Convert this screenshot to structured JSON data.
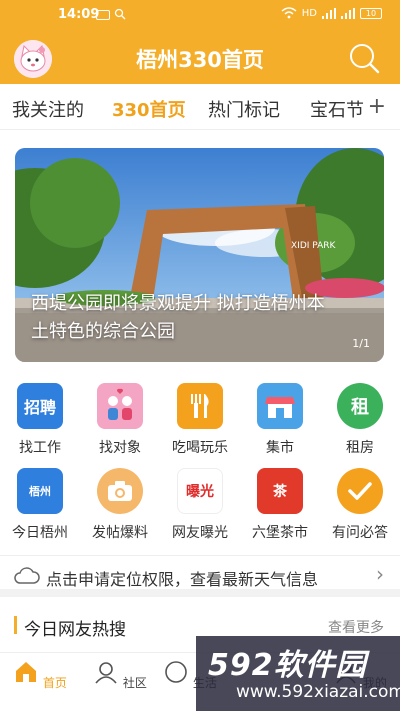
{
  "status": {
    "time": "14:09",
    "battery": "10",
    "network": "HD"
  },
  "header": {
    "title": "梧州330首页"
  },
  "tabs": [
    {
      "label": "我关注的"
    },
    {
      "label": "330首页"
    },
    {
      "label": "热门标记"
    },
    {
      "label": "宝石节"
    }
  ],
  "banner": {
    "caption": "西堤公园即将景观提升 拟打造梧州本土特色的综合公园",
    "pager": "1/1",
    "park_sign": "XIDI PARK"
  },
  "grid": [
    {
      "label": "找工作",
      "icon": "recruit-icon",
      "glyph": "招聘"
    },
    {
      "label": "找对象",
      "icon": "dating-icon",
      "glyph": ""
    },
    {
      "label": "吃喝玩乐",
      "icon": "food-icon",
      "glyph": ""
    },
    {
      "label": "集市",
      "icon": "market-icon",
      "glyph": ""
    },
    {
      "label": "租房",
      "icon": "rent-icon",
      "glyph": "租"
    },
    {
      "label": "今日梧州",
      "icon": "map-icon",
      "glyph": "梧州"
    },
    {
      "label": "发帖爆料",
      "icon": "camera-icon",
      "glyph": ""
    },
    {
      "label": "网友曝光",
      "icon": "expose-icon",
      "glyph": "曝光"
    },
    {
      "label": "六堡茶市",
      "icon": "tea-icon",
      "glyph": "茶"
    },
    {
      "label": "有问必答",
      "icon": "check-icon",
      "glyph": ""
    }
  ],
  "location": {
    "text": "点击申请定位权限，查看最新天气信息"
  },
  "hot": {
    "title": "今日网友热搜",
    "more": "查看更多"
  },
  "bottom_nav": [
    {
      "label": "首页"
    },
    {
      "label": "社区"
    },
    {
      "label": "生活"
    },
    {
      "label": "我的"
    }
  ],
  "watermark": {
    "big": "592软件园",
    "small": "www.592xiazai.com"
  },
  "colors": {
    "accent": "#f4ae2a",
    "active": "#f0a21c"
  }
}
